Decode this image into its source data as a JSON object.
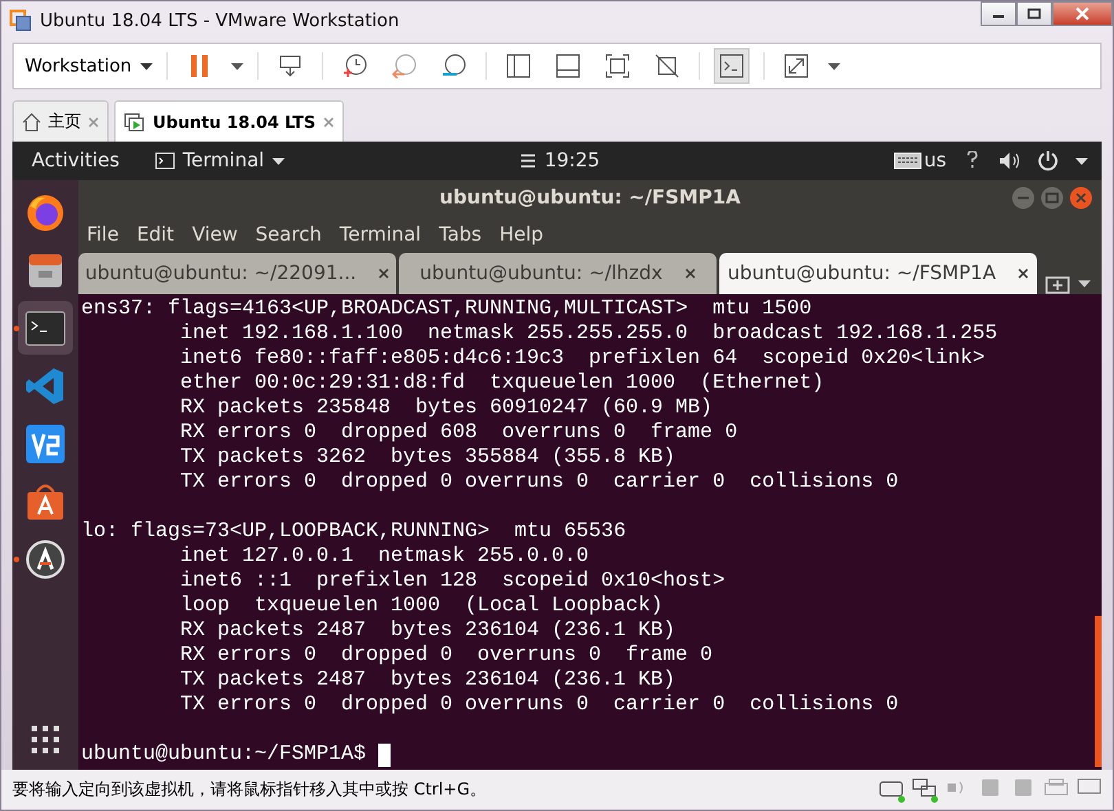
{
  "window": {
    "title": "Ubuntu 18.04 LTS - VMware Workstation"
  },
  "toolbar": {
    "menu": "Workstation",
    "console_view_on": true
  },
  "tabs": [
    {
      "label": "主页",
      "kind": "home",
      "selected": false
    },
    {
      "label": "Ubuntu 18.04 LTS",
      "kind": "vm",
      "selected": true
    }
  ],
  "guest": {
    "top_bar": {
      "activities": "Activities",
      "app_menu": "Terminal",
      "clock": "19:25",
      "keyboard": "us"
    },
    "dock": [
      {
        "kind": "firefox",
        "selected": false,
        "running": false
      },
      {
        "kind": "files",
        "selected": false,
        "running": false
      },
      {
        "kind": "terminal",
        "selected": true,
        "running": true
      },
      {
        "kind": "vscode",
        "selected": false,
        "running": false
      },
      {
        "kind": "vnc",
        "selected": false,
        "running": false
      },
      {
        "kind": "software",
        "selected": false,
        "running": false
      },
      {
        "kind": "updater",
        "selected": false,
        "running": true
      }
    ],
    "terminal": {
      "title": "ubuntu@ubuntu: ~/FSMP1A",
      "menu": [
        "File",
        "Edit",
        "View",
        "Search",
        "Terminal",
        "Tabs",
        "Help"
      ],
      "tabs": [
        {
          "label": "ubuntu@ubuntu: ~/22091...",
          "selected": false
        },
        {
          "label": "ubuntu@ubuntu: ~/lhzdx",
          "selected": false
        },
        {
          "label": "ubuntu@ubuntu: ~/FSMP1A",
          "selected": true
        }
      ],
      "output": [
        {
          "header": "ens37: flags=4163<UP,BROADCAST,RUNNING,MULTICAST>  mtu 1500",
          "lines": [
            "inet 192.168.1.100  netmask 255.255.255.0  broadcast 192.168.1.255",
            "inet6 fe80::faff:e805:d4c6:19c3  prefixlen 64  scopeid 0x20<link>",
            "ether 00:0c:29:31:d8:fd  txqueuelen 1000  (Ethernet)",
            "RX packets 235848  bytes 60910247 (60.9 MB)",
            "RX errors 0  dropped 608  overruns 0  frame 0",
            "TX packets 3262  bytes 355884 (355.8 KB)",
            "TX errors 0  dropped 0 overruns 0  carrier 0  collisions 0"
          ]
        },
        {
          "header": "lo: flags=73<UP,LOOPBACK,RUNNING>  mtu 65536",
          "lines": [
            "inet 127.0.0.1  netmask 255.0.0.0",
            "inet6 ::1  prefixlen 128  scopeid 0x10<host>",
            "loop  txqueuelen 1000  (Local Loopback)",
            "RX packets 2487  bytes 236104 (236.1 KB)",
            "RX errors 0  dropped 0  overruns 0  frame 0",
            "TX packets 2487  bytes 236104 (236.1 KB)",
            "TX errors 0  dropped 0 overruns 0  carrier 0  collisions 0"
          ]
        }
      ],
      "prompt": "ubuntu@ubuntu:~/FSMP1A$"
    }
  },
  "status_bar": {
    "message": "要将输入定向到该虚拟机，请将鼠标指针移入其中或按 Ctrl+G。",
    "devices": [
      {
        "kind": "disk",
        "active": true
      },
      {
        "kind": "network",
        "active": true
      },
      {
        "kind": "sound",
        "active": false
      },
      {
        "kind": "usb",
        "active": false
      },
      {
        "kind": "usb",
        "active": false
      },
      {
        "kind": "printer",
        "active": false
      },
      {
        "kind": "display",
        "active": false
      }
    ]
  }
}
